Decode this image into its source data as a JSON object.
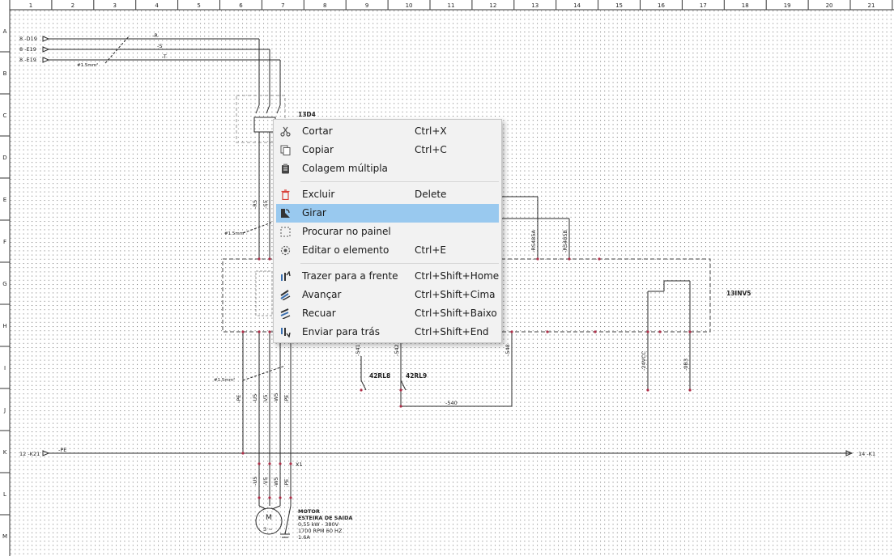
{
  "ruler": {
    "columns": [
      "1",
      "2",
      "3",
      "4",
      "5",
      "6",
      "7",
      "8",
      "9",
      "10",
      "11",
      "12",
      "13",
      "14",
      "15",
      "16",
      "17",
      "18",
      "19",
      "20",
      "21"
    ],
    "rows": [
      "A",
      "B",
      "C",
      "D",
      "E",
      "F",
      "G",
      "H",
      "I",
      "J",
      "K",
      "L",
      "M"
    ]
  },
  "schematic": {
    "sources": [
      "8 -D19",
      "8 -E19",
      "8 -E19"
    ],
    "phases": [
      "-R",
      "-S",
      "-T"
    ],
    "wire_section_1": "#1.5mm²",
    "wire_section_2": "#1.5mm²",
    "wire_section_3": "#1.5mm²",
    "breaker": "13D4",
    "vert_wires": [
      "-R5",
      "-S5"
    ],
    "bus_left": "12 -K21",
    "bus_left_label": "-PE",
    "bus_right": "14 -K1",
    "relay_a": "42RL8",
    "relay_b": "42RL9",
    "relay_wire": "-540",
    "relay_wires": [
      "-541",
      "-542",
      "-548"
    ],
    "inverter": "13INV5",
    "signals": [
      "-RS485A",
      "-RS485B",
      "-24VCC",
      "-0B3"
    ],
    "lower_wires": [
      "-PE",
      "-U5",
      "-V5",
      "-W5",
      "-PE"
    ],
    "terminal": "X1",
    "motor_wires": [
      "-U5",
      "-V5",
      "-W5",
      "-PE"
    ],
    "motor_symbol": "M",
    "motor_phase": "3 ~",
    "motor_title": "MOTOR",
    "motor_lines": [
      "ESTEIRA DE SAIDA",
      "0,55 kW - 380V",
      "1700 RPM 60 HZ",
      "1.6A"
    ]
  },
  "context_menu": {
    "items": [
      {
        "label": "Cortar",
        "shortcut": "Ctrl+X",
        "icon": "scissors-icon"
      },
      {
        "label": "Copiar",
        "shortcut": "Ctrl+C",
        "icon": "copy-icon"
      },
      {
        "label": "Colagem múltipla",
        "shortcut": "",
        "icon": "paste-multiple-icon"
      },
      {
        "label": "Excluir",
        "shortcut": "Delete",
        "icon": "trash-icon"
      },
      {
        "label": "Girar",
        "shortcut": "",
        "icon": "rotate-icon"
      },
      {
        "label": "Procurar no painel",
        "shortcut": "",
        "icon": "dashed-square-icon"
      },
      {
        "label": "Editar o elemento",
        "shortcut": "Ctrl+E",
        "icon": "edit-element-icon"
      },
      {
        "label": "Trazer para a frente",
        "shortcut": "Ctrl+Shift+Home",
        "icon": "bring-front-icon"
      },
      {
        "label": "Avançar",
        "shortcut": "Ctrl+Shift+Cima",
        "icon": "raise-icon"
      },
      {
        "label": "Recuar",
        "shortcut": "Ctrl+Shift+Baixo",
        "icon": "lower-icon"
      },
      {
        "label": "Enviar para trás",
        "shortcut": "Ctrl+Shift+End",
        "icon": "send-back-icon"
      }
    ]
  },
  "colors": {
    "highlight": "#99c9ef",
    "wire": "#2a2a2a",
    "node": "#b0304a",
    "delete_icon": "#d9413a",
    "menu_bg": "#f2f2f2"
  }
}
